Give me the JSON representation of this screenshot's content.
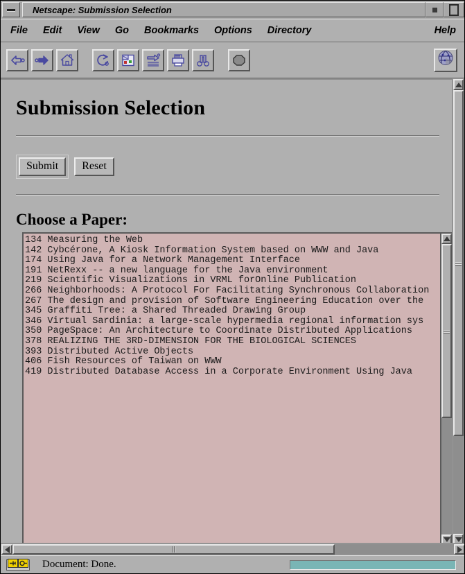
{
  "window": {
    "title": "Netscape: Submission Selection",
    "minimize_label": "minimize",
    "maximize_label": "maximize"
  },
  "menubar": {
    "items": [
      {
        "label": "File"
      },
      {
        "label": "Edit"
      },
      {
        "label": "View"
      },
      {
        "label": "Go"
      },
      {
        "label": "Bookmarks"
      },
      {
        "label": "Options"
      },
      {
        "label": "Directory"
      }
    ],
    "help": "Help"
  },
  "toolbar": {
    "buttons": [
      {
        "name": "back-button",
        "icon": "back-arrow-icon",
        "label": "Back"
      },
      {
        "name": "forward-button",
        "icon": "forward-arrow-icon",
        "label": "Forward"
      },
      {
        "name": "home-button",
        "icon": "home-icon",
        "label": "Home"
      },
      {
        "name": "reload-button",
        "icon": "reload-icon",
        "label": "Reload"
      },
      {
        "name": "images-button",
        "icon": "images-icon",
        "label": "Images"
      },
      {
        "name": "open-button",
        "icon": "open-icon",
        "label": "Open"
      },
      {
        "name": "print-button",
        "icon": "printer-icon",
        "label": "Print"
      },
      {
        "name": "find-button",
        "icon": "binoculars-icon",
        "label": "Find"
      },
      {
        "name": "stop-button",
        "icon": "stop-octagon-icon",
        "label": "Stop"
      }
    ],
    "logo": {
      "name": "netscape-logo-button",
      "icon": "netscape-globe-icon"
    }
  },
  "page": {
    "heading": "Submission Selection",
    "submit_label": "Submit",
    "reset_label": "Reset",
    "subheading": "Choose a Paper:",
    "background_color": "#b0b0b0",
    "listbox_background_color": "#d0b4b4",
    "papers": [
      "134 Measuring the Web",
      "142 Cybcérone, A Kiosk Information System based on WWW and Java",
      "174 Using Java for a Network Management Interface",
      "191 NetRexx -- a new language for the Java environment",
      "219 Scientific Visualizations in VRML forOnline Publication",
      "266 Neighborhoods: A Protocol For Facilitating Synchronous Collaboration",
      "267 The design and provision of Software Engineering Education over the",
      "345 Graffiti Tree: a Shared Threaded Drawing Group",
      "346 Virtual Sardinia: a large-scale hypermedia regional information sys",
      "350 PageSpace: An Architecture to Coordinate Distributed Applications",
      "378 REALIZING THE 3RD-DIMENSION FOR THE BIOLOGICAL SCIENCES",
      "393 Distributed Active Objects",
      "406 Fish Resources of Taiwan on WWW",
      "419 Distributed Database Access in a Corporate Environment Using Java"
    ]
  },
  "statusbar": {
    "security_icon": "broken-key-icon",
    "message": "Document: Done.",
    "progress_percent": 100,
    "progress_color": "#79b5b5"
  }
}
